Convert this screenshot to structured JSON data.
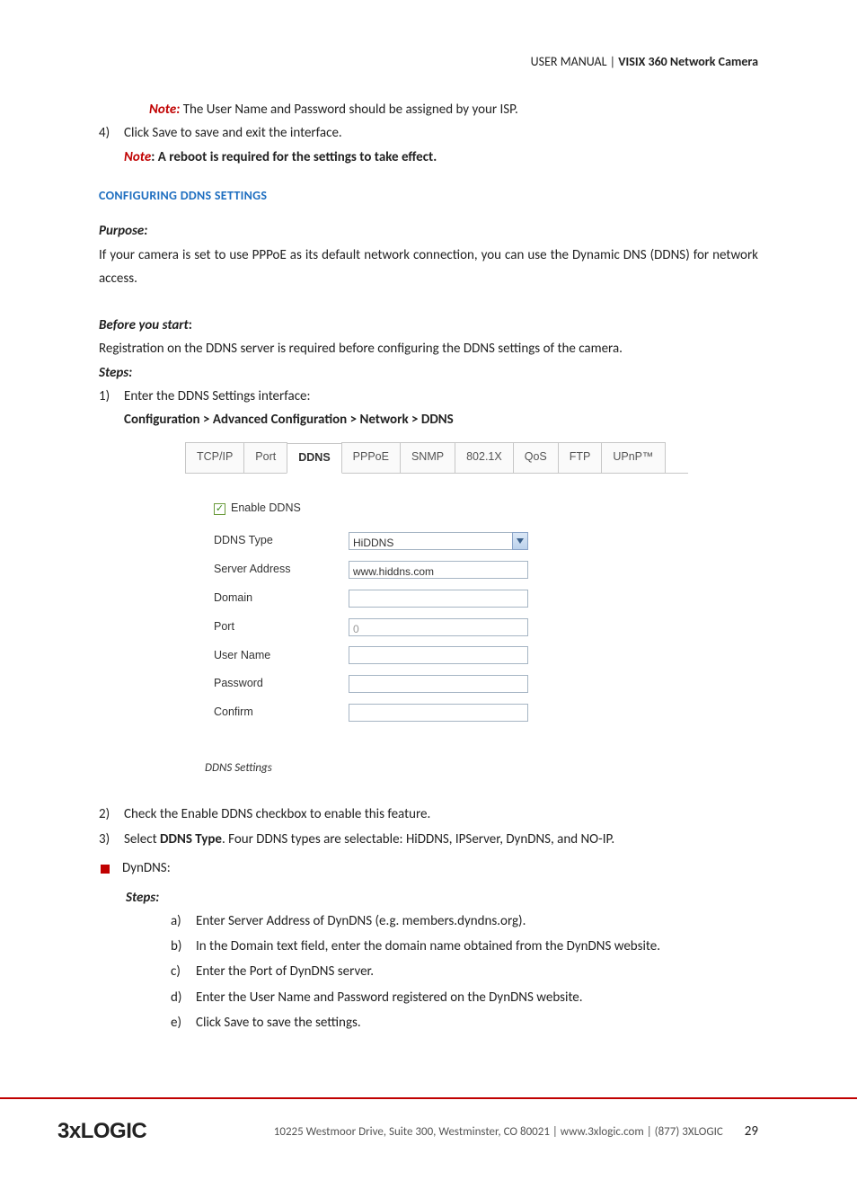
{
  "header": {
    "left": "USER MANUAL | ",
    "right": "VISIX 360 Network Camera"
  },
  "top_note": {
    "label": "Note:",
    "text": " The User Name and Password should be assigned by your ISP."
  },
  "step4": {
    "line1": "Click Save to save and exit the interface.",
    "note_label": "Note",
    "note_rest": ": A reboot is required for the settings to take effect."
  },
  "ddns_heading": "CONFIGURING DDNS SETTINGS",
  "purpose_label": "Purpose:",
  "purpose_text": "If your camera is set to use PPPoE as its default network connection, you can use the Dynamic DNS (DDNS) for network access.",
  "before_label": "Before you start",
  "before_colon": ":",
  "before_text": "Registration on the DDNS server is required before configuring the DDNS settings of the camera.",
  "steps_label": "Steps:",
  "step1": {
    "line": "Enter the DDNS Settings interface:",
    "path": "Configuration > Advanced Configuration > Network > DDNS"
  },
  "ui": {
    "tabs": [
      "TCP/IP",
      "Port",
      "DDNS",
      "PPPoE",
      "SNMP",
      "802.1X",
      "QoS",
      "FTP",
      "UPnP™"
    ],
    "active_tab_index": 2,
    "enable_label": "Enable DDNS",
    "enable_checked": true,
    "rows": [
      {
        "label": "DDNS Type",
        "type": "select",
        "value": "HiDDNS"
      },
      {
        "label": "Server Address",
        "type": "text",
        "value": "www.hiddns.com"
      },
      {
        "label": "Domain",
        "type": "text",
        "value": ""
      },
      {
        "label": "Port",
        "type": "text",
        "value": "",
        "placeholder": "0"
      },
      {
        "label": "User Name",
        "type": "text",
        "value": ""
      },
      {
        "label": "Password",
        "type": "password",
        "value": ""
      },
      {
        "label": "Confirm",
        "type": "password",
        "value": ""
      }
    ]
  },
  "caption": "DDNS Settings",
  "step2": "Check the Enable DDNS checkbox to enable this feature.",
  "step3": {
    "pre": "Select ",
    "bold": "DDNS Type",
    "post": ". Four DDNS types are selectable: HiDDNS, IPServer, DynDNS, and NO-IP."
  },
  "dyndns_label": "DynDNS:",
  "substeps_label": "Steps:",
  "sub": {
    "a": "Enter Server Address of DynDNS (e.g. members.dyndns.org).",
    "b": "In the Domain text field, enter the domain name obtained from the DynDNS website.",
    "c": "Enter the Port of DynDNS server.",
    "d": "Enter the User Name and Password registered on the DynDNS website.",
    "e": "Click Save to save the settings."
  },
  "footer": {
    "logo": "3xLOGIC",
    "text": "10225 Westmoor Drive, Suite 300, Westminster, CO 80021 | www.3xlogic.com | (877) 3XLOGIC",
    "page": "29"
  }
}
